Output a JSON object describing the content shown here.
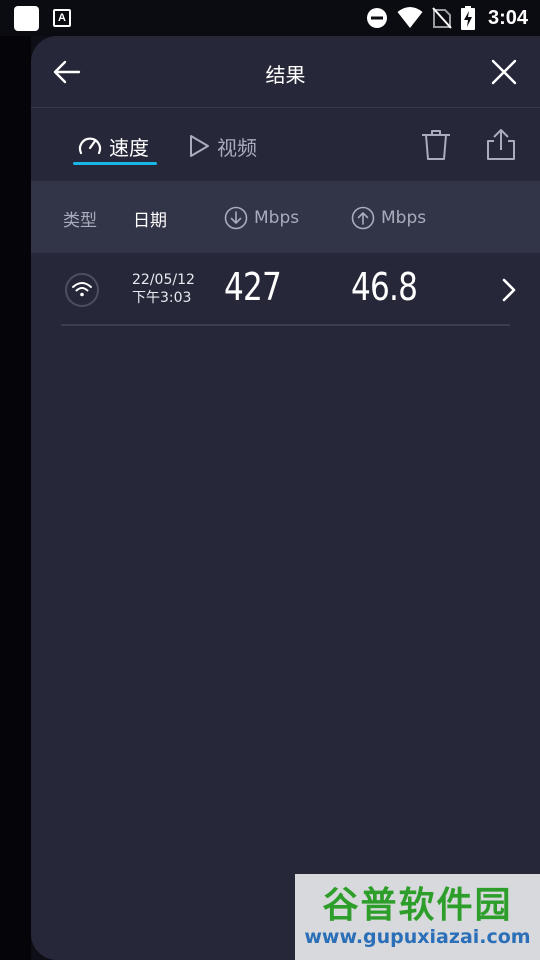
{
  "status_bar": {
    "time": "3:04",
    "icons": [
      "notification-square-icon",
      "keyboard-a-icon",
      "do-not-disturb-icon",
      "wifi-icon",
      "no-sim-icon",
      "battery-charging-icon"
    ]
  },
  "header": {
    "title": "结果",
    "back_icon": "arrow-left-icon",
    "close_icon": "close-icon"
  },
  "tabs": {
    "speed_label": "速度",
    "video_label": "视频",
    "active": "speed",
    "accent_color": "#19b6e8"
  },
  "toolbar": {
    "delete_icon": "trash-icon",
    "share_icon": "share-icon"
  },
  "table": {
    "headers": {
      "type": "类型",
      "date": "日期",
      "download": "Mbps",
      "upload": "Mbps"
    },
    "rows": [
      {
        "type_icon": "wifi-icon",
        "date": "22/05/12",
        "time": "下午3:03",
        "download": "427",
        "upload": "46.8"
      }
    ]
  },
  "watermark": {
    "title": "谷普软件园",
    "url": "www.gupuxiazai.com"
  },
  "colors": {
    "panel_bg": "#262839",
    "header_row_bg": "#323547",
    "muted_text": "#a9acbd"
  }
}
